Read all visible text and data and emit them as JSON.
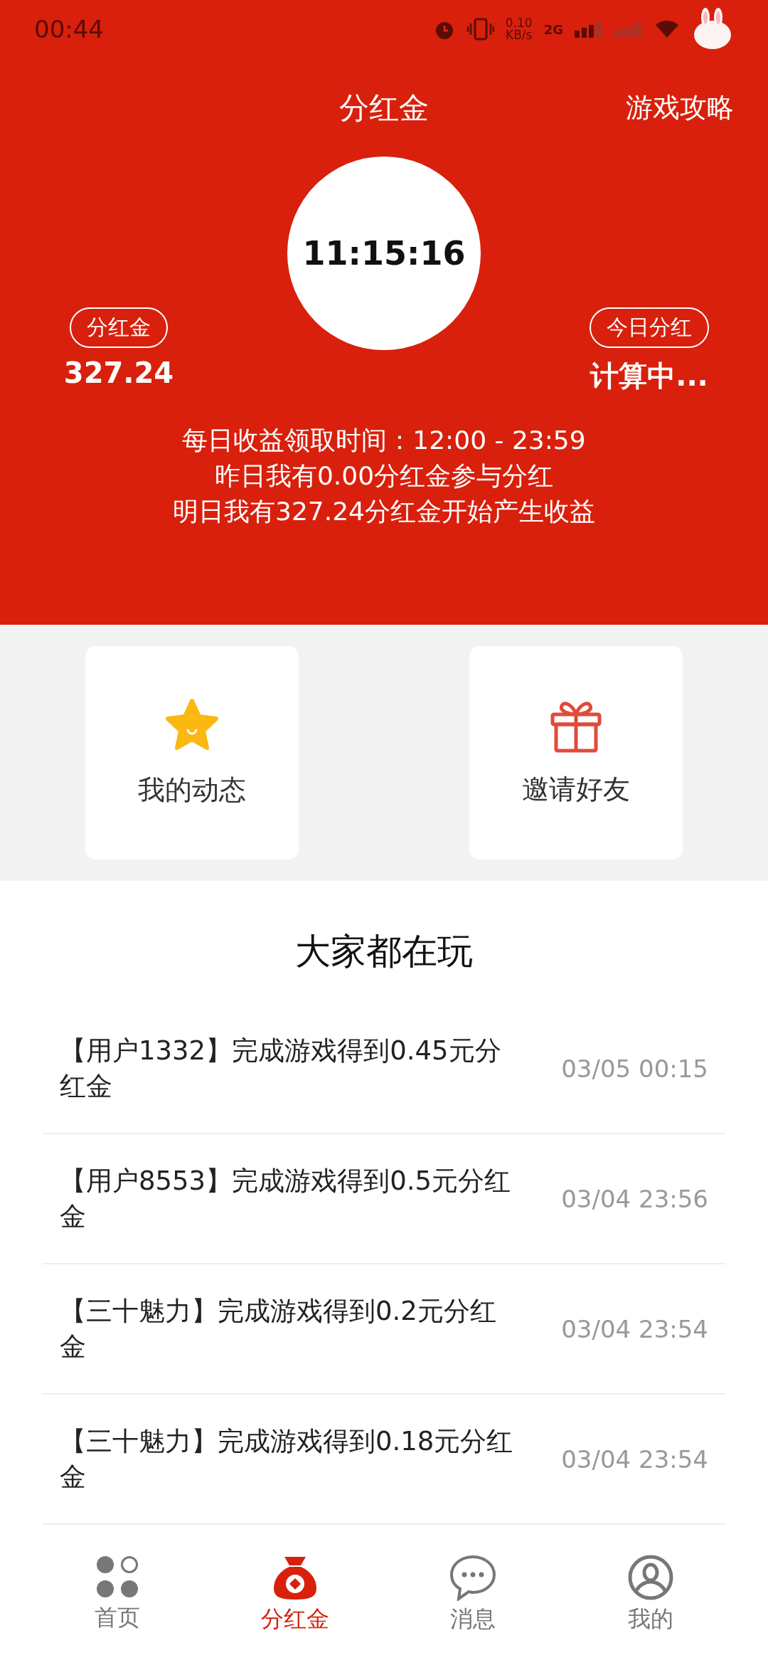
{
  "status_bar": {
    "time": "00:44",
    "net_speed": "0.10",
    "net_unit": "KB/s",
    "network": "2G"
  },
  "header": {
    "title": "分红金",
    "action": "游戏攻略"
  },
  "timer": "11:15:16",
  "stats": [
    {
      "label": "分红金",
      "value": "327.24"
    },
    {
      "label": "今日分红",
      "value": "计算中..."
    }
  ],
  "info_lines": [
    "每日收益领取时间：12:00 - 23:59",
    "昨日我有0.00分红金参与分红",
    "明日我有327.24分红金开始产生收益"
  ],
  "shortcuts": [
    {
      "kind": "star",
      "label": "我的动态"
    },
    {
      "kind": "gift",
      "label": "邀请好友"
    }
  ],
  "feed": {
    "title": "大家都在玩",
    "items": [
      {
        "text": "【用户1332】完成游戏得到0.45元分红金",
        "time": "03/05 00:15"
      },
      {
        "text": "【用户8553】完成游戏得到0.5元分红金",
        "time": "03/04 23:56"
      },
      {
        "text": "【三十魅力】完成游戏得到0.2元分红金",
        "time": "03/04 23:54"
      },
      {
        "text": "【三十魅力】完成游戏得到0.18元分红金",
        "time": "03/04 23:54"
      }
    ]
  },
  "tab_bar": [
    {
      "kind": "home",
      "label": "首页",
      "selected": false
    },
    {
      "kind": "bag",
      "label": "分红金",
      "selected": true
    },
    {
      "kind": "chat",
      "label": "消息",
      "selected": false
    },
    {
      "kind": "user",
      "label": "我的",
      "selected": false
    }
  ]
}
